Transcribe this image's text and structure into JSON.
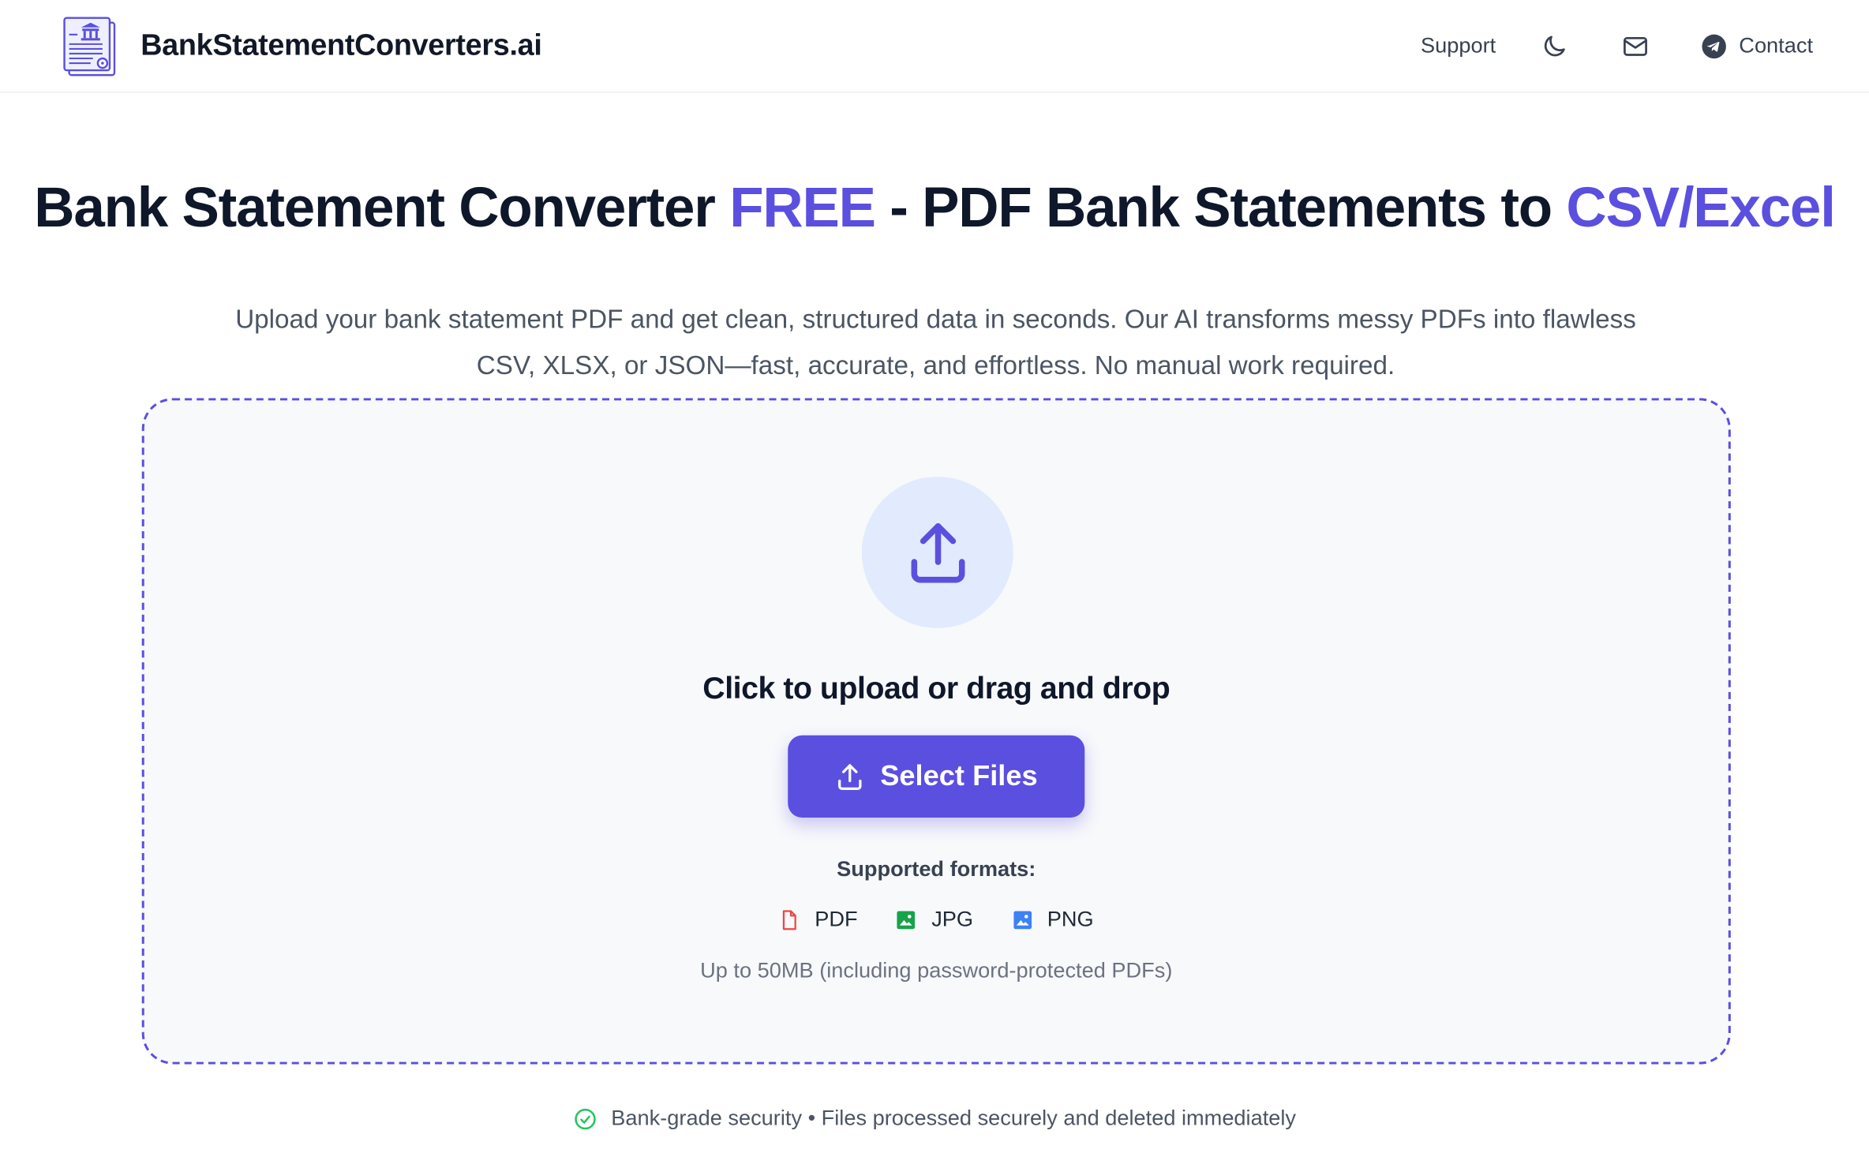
{
  "header": {
    "brand_name": "BankStatementConverters.ai",
    "nav": {
      "support_label": "Support",
      "contact_label": "Contact"
    }
  },
  "hero": {
    "title_part1": "Bank Statement Converter ",
    "title_accent1": "FREE",
    "title_part2": " - PDF Bank Statements to ",
    "title_accent2": "CSV/Excel",
    "subtitle": "Upload your bank statement PDF and get clean, structured data in seconds. Our AI transforms messy PDFs into flawless CSV, XLSX, or JSON—fast, accurate, and effortless. No manual work required."
  },
  "upload": {
    "title": "Click to upload or drag and drop",
    "button_label": "Select Files",
    "formats_label": "Supported formats:",
    "formats": [
      {
        "label": "PDF",
        "icon": "file-pdf-icon",
        "color": "#ef4444"
      },
      {
        "label": "JPG",
        "icon": "image-icon",
        "color": "#16a34a"
      },
      {
        "label": "PNG",
        "icon": "image-icon",
        "color": "#3b82f6"
      }
    ],
    "limit_text": "Up to 50MB (including password-protected PDFs)"
  },
  "security": {
    "text": "Bank-grade security • Files processed securely and deleted immediately"
  },
  "colors": {
    "accent": "#5b4fe0",
    "upload_circle": "#e2eafd",
    "check": "#22c55e"
  }
}
